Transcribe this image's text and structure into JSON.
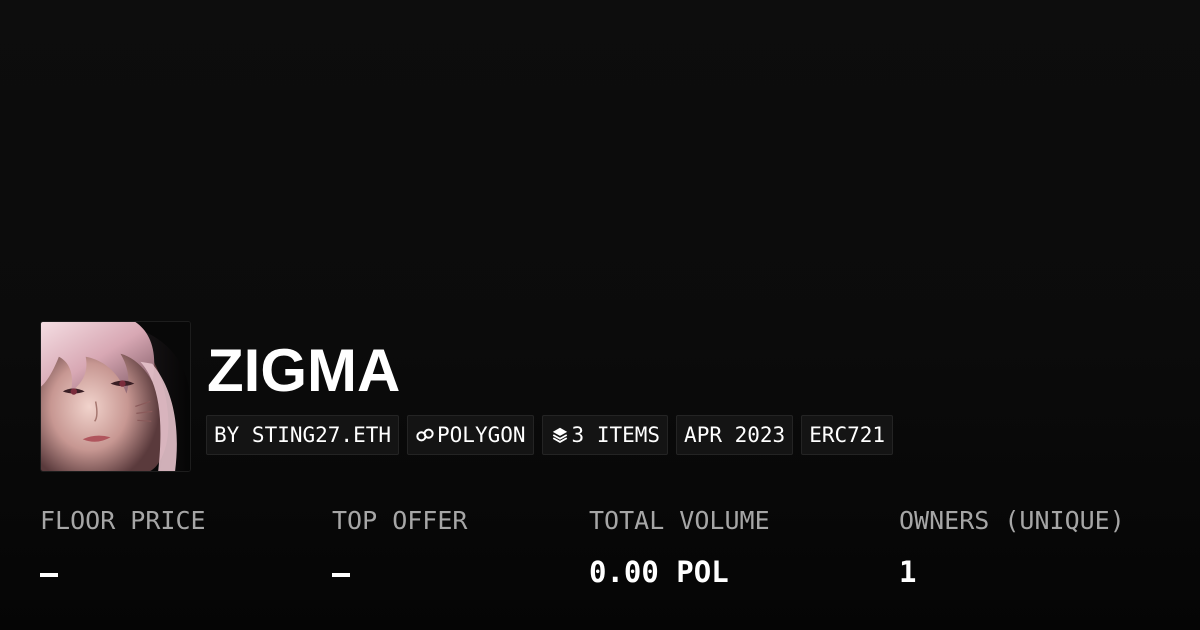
{
  "collection": {
    "name": "ZIGMA",
    "avatar_icon": "anime-portrait-avatar"
  },
  "chips": {
    "creator": "BY STING27.ETH",
    "chain": "POLYGON",
    "chain_icon": "polygon-link-icon",
    "items": "3 ITEMS",
    "items_icon": "layers-icon",
    "date": "APR 2023",
    "standard": "ERC721"
  },
  "stats": {
    "floor_price": {
      "label": "FLOOR PRICE",
      "value": "—"
    },
    "top_offer": {
      "label": "TOP OFFER",
      "value": "—"
    },
    "total_volume": {
      "label": "TOTAL VOLUME",
      "value": "0.00 POL"
    },
    "owners": {
      "label": "OWNERS (UNIQUE)",
      "value": "1"
    }
  },
  "colors": {
    "background": "#0b0b0b",
    "chip_background": "#141414",
    "label_gray": "#a6a6a6",
    "text_white": "#ffffff"
  }
}
